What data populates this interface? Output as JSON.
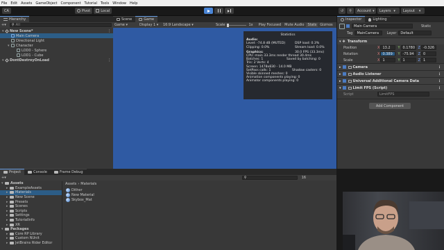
{
  "menu": [
    "File",
    "Edit",
    "Assets",
    "GameObject",
    "Component",
    "Tutorial",
    "Tools",
    "Window",
    "Help"
  ],
  "toolbar": {
    "account_label": "CA",
    "pivot_label": "Pivot",
    "local_label": "Local",
    "account": "Account",
    "layers": "Layers",
    "layout": "Layout"
  },
  "hierarchy": {
    "tab": "Hierarchy",
    "search_placeholder": "All",
    "items": [
      {
        "label": "New Scene*",
        "depth": 0,
        "kind": "scene"
      },
      {
        "label": "Main Camera",
        "depth": 1,
        "kind": "obj",
        "selected": true
      },
      {
        "label": "Directional Light",
        "depth": 1,
        "kind": "obj"
      },
      {
        "label": "Character",
        "depth": 1,
        "kind": "obj"
      },
      {
        "label": "LOD0 - Sphere",
        "depth": 2,
        "kind": "obj"
      },
      {
        "label": "LOD1 - Cube",
        "depth": 2,
        "kind": "obj"
      },
      {
        "label": "DontDestroyOnLoad",
        "depth": 0,
        "kind": "scene"
      }
    ]
  },
  "game": {
    "tabs": [
      "Scene",
      "Game"
    ],
    "display": "Display 1",
    "resolution": "16:9 Landscape",
    "scale_label": "Scale",
    "scale_value": "1x",
    "buttons": [
      "Play Focused",
      "Mute Audio",
      "Stats",
      "Gizmos"
    ]
  },
  "stats": {
    "title": "Statistics",
    "audio_header": "Audio:",
    "rows_audio": [
      [
        "Level: -74.8 dB (MUTED)",
        "DSP load: 0.3%"
      ],
      [
        "Clipping: 0.0%",
        "Stream load: 0.0%"
      ]
    ],
    "fps": "30.0 FPS (33.3ms)",
    "graphics_header": "Graphics:",
    "cpu": "CPU: main 33.3ms  render thread 30.4ms",
    "batches": "Batches: 1",
    "saved_batching": "Saved by batching: 0",
    "tris": "Tris: 2  Verts: 4",
    "screen": "Screen: 1478x830 - 14.0 MB",
    "setpass": "SetPass calls: 1",
    "shadow": "Shadow casters: 0",
    "skinned": "Visible skinned meshes: 0",
    "anim": "Animation components playing: 0",
    "animator": "Animator components playing: 0"
  },
  "inspector": {
    "tabs": [
      "Inspector",
      "Lighting"
    ],
    "object_name": "Main Camera",
    "static_label": "Static",
    "tag_label": "Tag",
    "tag_value": "MainCamera",
    "layer_label": "Layer",
    "layer_value": "Default",
    "transform": {
      "title": "Transform",
      "position": {
        "label": "Position",
        "x": "13.2",
        "y": "0.1780",
        "z": "-0.326"
      },
      "rotation": {
        "label": "Rotation",
        "x": "0.389",
        "y": "-75.94",
        "z": "0"
      },
      "scale": {
        "label": "Scale",
        "x": "1",
        "y": "1",
        "z": "1"
      }
    },
    "components": [
      "Camera",
      "Audio Listener",
      "Universal Additional Camera Data",
      "Limit FPS (Script)"
    ],
    "script_label": "Script",
    "script_value": "LimitFPS",
    "add_component": "Add Component"
  },
  "project": {
    "tabs": [
      "Project",
      "Console",
      "Frame Debug"
    ],
    "tree": [
      {
        "label": "Assets",
        "depth": 0
      },
      {
        "label": "ExampleAssets",
        "depth": 1
      },
      {
        "label": "Materials",
        "depth": 1,
        "selected": true
      },
      {
        "label": "New Scene",
        "depth": 1
      },
      {
        "label": "Presets",
        "depth": 1
      },
      {
        "label": "Scenes",
        "depth": 1
      },
      {
        "label": "Scripts",
        "depth": 1
      },
      {
        "label": "Settings",
        "depth": 1
      },
      {
        "label": "TutorialInfo",
        "depth": 1
      },
      {
        "label": "XR",
        "depth": 1
      },
      {
        "label": "Packages",
        "depth": 0
      },
      {
        "label": "Core RP Library",
        "depth": 1
      },
      {
        "label": "Custom NUnit",
        "depth": 1
      },
      {
        "label": "JetBrains Rider Editor",
        "depth": 1
      }
    ],
    "breadcrumb": [
      "Assets",
      "Materials"
    ],
    "files": [
      "Dither",
      "New Material",
      "Skybox_Mat"
    ],
    "item_count": "16"
  },
  "colors": {
    "game_bg": "#2f5aa3",
    "selection": "#2c5d87",
    "accent": "#4a85d6"
  }
}
